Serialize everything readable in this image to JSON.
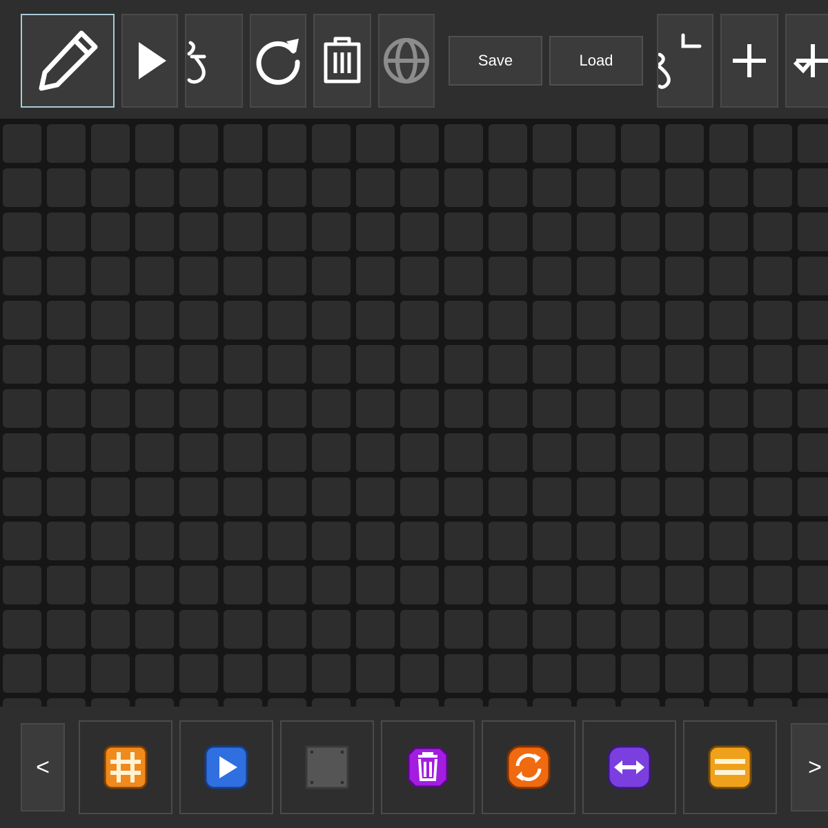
{
  "toolbar": {
    "tools": [
      {
        "name": "pencil-icon",
        "selected": true
      },
      {
        "name": "play-icon"
      },
      {
        "name": "glyph-icon"
      },
      {
        "name": "refresh-icon"
      },
      {
        "name": "trash-icon"
      },
      {
        "name": "globe-icon"
      }
    ],
    "save_label": "Save",
    "load_label": "Load",
    "extra_tools": [
      "glyph-corner-icon",
      "plus-icon",
      "plus-check-icon"
    ]
  },
  "palette": {
    "prev_label": "<",
    "next_label": ">",
    "items": [
      {
        "name": "hash-block-icon",
        "color": "#f08a1c"
      },
      {
        "name": "play-block-icon",
        "color": "#2f6fe0"
      },
      {
        "name": "empty-block-icon",
        "color": "#555555"
      },
      {
        "name": "trash-block-icon",
        "color": "#a21de0"
      },
      {
        "name": "refresh-block-icon",
        "color": "#f06a10"
      },
      {
        "name": "swap-block-icon",
        "color": "#7b3fe0"
      },
      {
        "name": "lines-block-icon",
        "color": "#f0a11c"
      }
    ]
  },
  "colors": {
    "background": "#161616",
    "panel": "#2e2e2e",
    "cell": "#2d2d2d",
    "selected_border": "#a9cbd8"
  }
}
